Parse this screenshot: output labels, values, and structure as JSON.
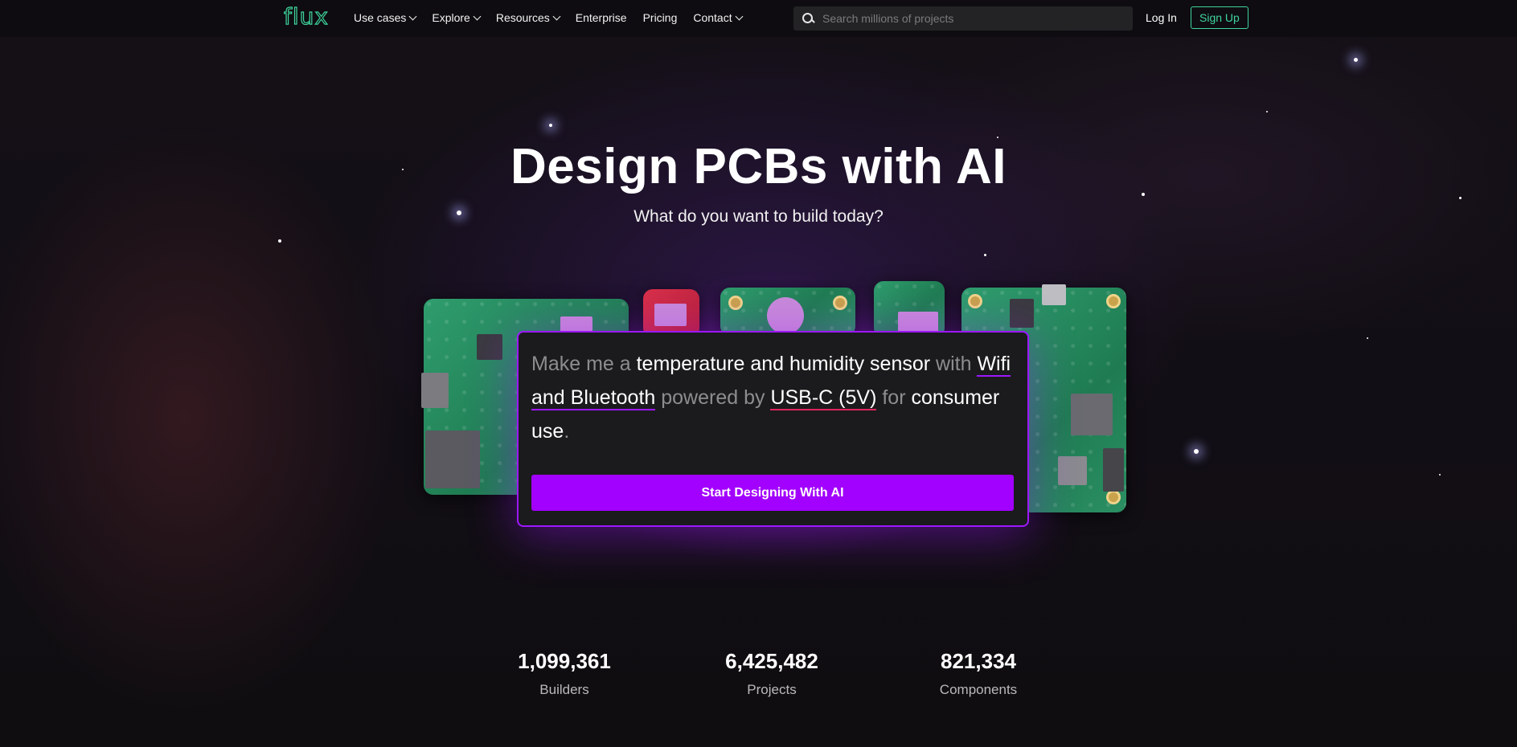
{
  "header": {
    "logo_text": "flux",
    "nav": [
      {
        "label": "Use cases",
        "has_dropdown": true
      },
      {
        "label": "Explore",
        "has_dropdown": true
      },
      {
        "label": "Resources",
        "has_dropdown": true
      },
      {
        "label": "Enterprise",
        "has_dropdown": false
      },
      {
        "label": "Pricing",
        "has_dropdown": false
      },
      {
        "label": "Contact",
        "has_dropdown": true
      }
    ],
    "search": {
      "placeholder": "Search millions of projects",
      "value": "",
      "icon": "search-icon"
    },
    "login_label": "Log In",
    "signup_label": "Sign Up"
  },
  "hero": {
    "title": "Design PCBs with AI",
    "subtitle": "What do you want to build today?"
  },
  "prompt_card": {
    "p1": "Make me a ",
    "device": "temperature and humidity sensor",
    "p2": " with ",
    "connectivity": "Wifi and Bluetooth",
    "p3": " powered by ",
    "power": "USB-C (5V)",
    "p4": " for ",
    "use": "consumer use",
    "p5": ".",
    "button_label": "Start Designing With AI"
  },
  "stats": [
    {
      "value": "1,099,361",
      "label": "Builders"
    },
    {
      "value": "6,425,482",
      "label": "Projects"
    },
    {
      "value": "821,334",
      "label": "Components"
    }
  ],
  "colors": {
    "accent_purple": "#a200ff",
    "accent_green": "#3fd49d",
    "underline_red": "#e0245e",
    "background": "#0f0d10"
  }
}
